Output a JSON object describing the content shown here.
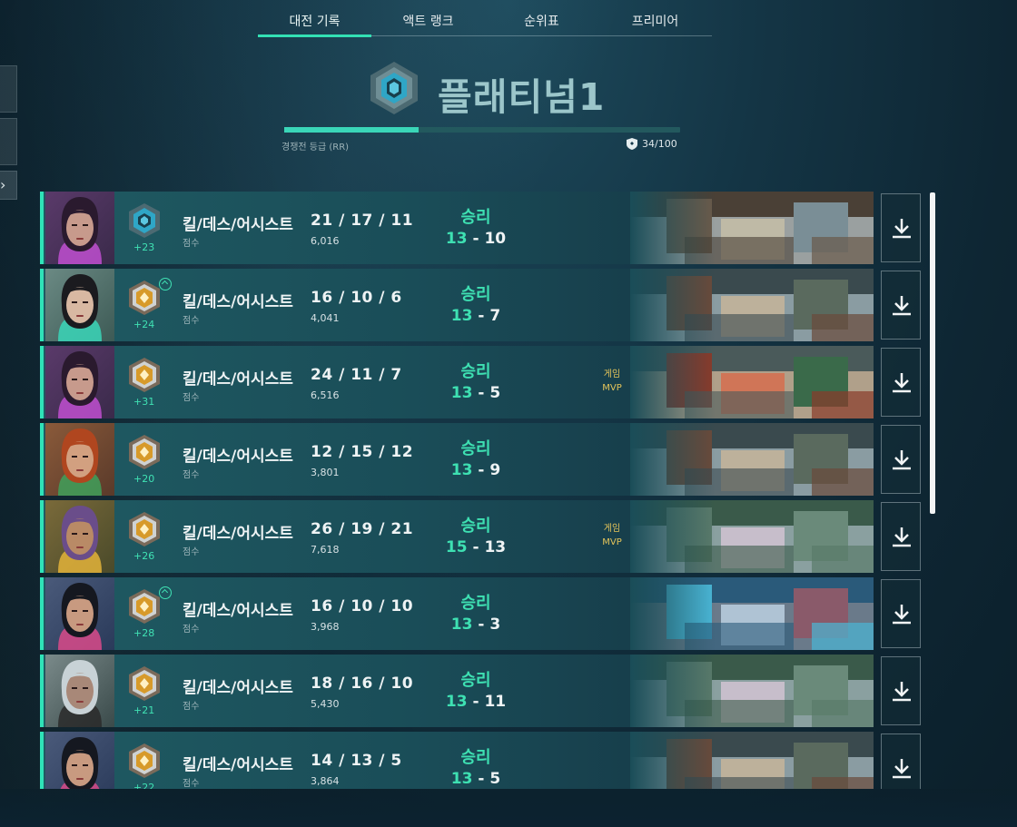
{
  "tabs": [
    "대전 기록",
    "액트 랭크",
    "순위표",
    "프리미어"
  ],
  "active_tab": 0,
  "rank": {
    "name": "플래티넘1",
    "rr_label": "경쟁전 등급 (RR)",
    "rr_value": "34/100",
    "rr_progress": 0.34
  },
  "labels": {
    "kda": "킬/데스/어시스트",
    "score": "점수",
    "mvp_line1": "게임",
    "mvp_line2": "MVP"
  },
  "colors": {
    "accent": "#33e0b4",
    "mvp": "#e4c45a",
    "platinum": "#4fb6c9",
    "gold": "#d79a2a"
  },
  "matches": [
    {
      "rank_badge": "platinum",
      "rr_delta": "+23",
      "rank_up": false,
      "kda": "21 / 17 / 11",
      "score": "6,016",
      "result": "승리",
      "team_score": "13",
      "enemy_score": "10",
      "mvp": false,
      "agent": "reyna",
      "map": "industrial"
    },
    {
      "rank_badge": "gold",
      "rr_delta": "+24",
      "rank_up": true,
      "kda": "16 / 10 / 6",
      "score": "4,041",
      "result": "승리",
      "team_score": "13",
      "enemy_score": "7",
      "mvp": false,
      "agent": "sage",
      "map": "city"
    },
    {
      "rank_badge": "gold",
      "rr_delta": "+31",
      "rank_up": false,
      "kda": "24 / 11 / 7",
      "score": "6,516",
      "result": "승리",
      "team_score": "13",
      "enemy_score": "5",
      "mvp": true,
      "agent": "reyna",
      "map": "rooftops"
    },
    {
      "rank_badge": "gold",
      "rr_delta": "+20",
      "rank_up": false,
      "kda": "12 / 15 / 12",
      "score": "3,801",
      "result": "승리",
      "team_score": "13",
      "enemy_score": "9",
      "mvp": false,
      "agent": "phoenix-red",
      "map": "city"
    },
    {
      "rank_badge": "gold",
      "rr_delta": "+26",
      "rank_up": false,
      "kda": "26 / 19 / 21",
      "score": "7,618",
      "result": "승리",
      "team_score": "15",
      "enemy_score": "13",
      "mvp": true,
      "agent": "skye",
      "map": "jungle"
    },
    {
      "rank_badge": "gold",
      "rr_delta": "+28",
      "rank_up": true,
      "kda": "16 / 10 / 10",
      "score": "3,968",
      "result": "승리",
      "team_score": "13",
      "enemy_score": "3",
      "mvp": false,
      "agent": "neon",
      "map": "canal"
    },
    {
      "rank_badge": "gold",
      "rr_delta": "+21",
      "rank_up": false,
      "kda": "18 / 16 / 10",
      "score": "5,430",
      "result": "승리",
      "team_score": "13",
      "enemy_score": "11",
      "mvp": false,
      "agent": "viper",
      "map": "jungle"
    },
    {
      "rank_badge": "gold",
      "rr_delta": "+22",
      "rank_up": false,
      "kda": "14 / 13 / 5",
      "score": "3,864",
      "result": "승리",
      "team_score": "13",
      "enemy_score": "5",
      "mvp": false,
      "agent": "neon",
      "map": "city"
    }
  ]
}
